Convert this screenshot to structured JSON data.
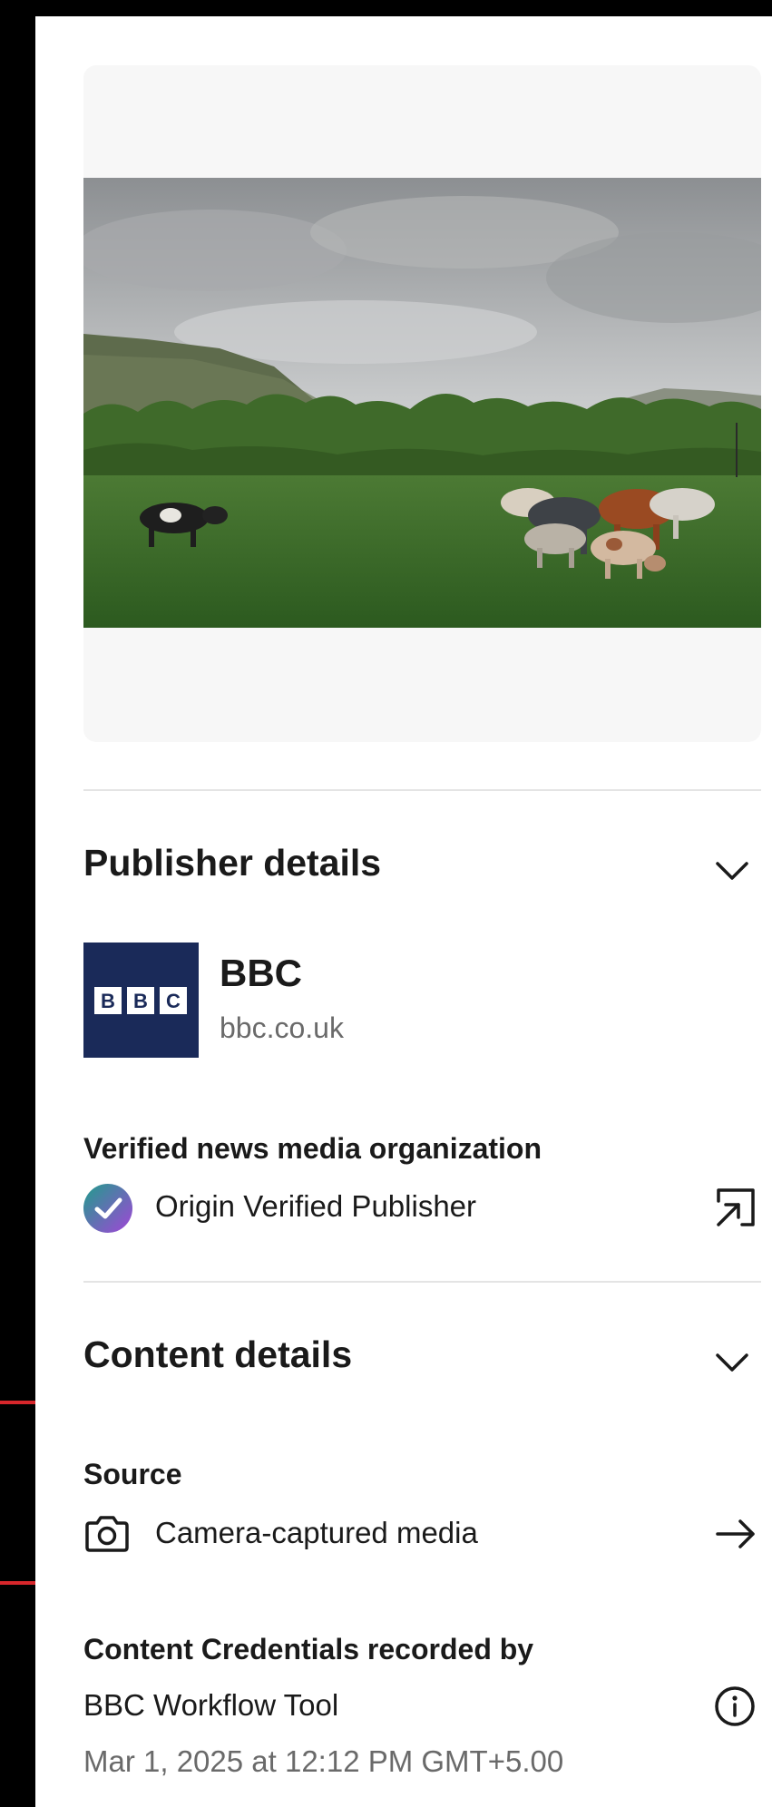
{
  "colors": {
    "background": "#000000",
    "panel": "#ffffff",
    "accent_red": "#d7262b",
    "bbc_navy": "#1a2a59",
    "badge_gradient": [
      "#1f9d8b",
      "#a245d8"
    ]
  },
  "media": {
    "image_alt": "Cows grazing in a green field beneath a mountain"
  },
  "publisher": {
    "heading": "Publisher details",
    "logo_letters": [
      "B",
      "B",
      "C"
    ],
    "name": "BBC",
    "domain": "bbc.co.uk",
    "verified_label": "Verified news media organization",
    "verification": "Origin Verified Publisher",
    "icons": {
      "collapse": "chevron-down-icon",
      "badge": "verified-check-icon",
      "external": "open-external-icon"
    }
  },
  "content": {
    "heading": "Content details",
    "source_label": "Source",
    "source_value": "Camera-captured media",
    "recorded_by_label": "Content Credentials recorded by",
    "recorded_by_value": "BBC Workflow Tool",
    "timestamp": "Mar 1, 2025 at 12:12 PM GMT+5.00",
    "icons": {
      "collapse": "chevron-down-icon",
      "source": "camera-icon",
      "navigate": "arrow-right-icon",
      "info": "info-icon"
    }
  }
}
